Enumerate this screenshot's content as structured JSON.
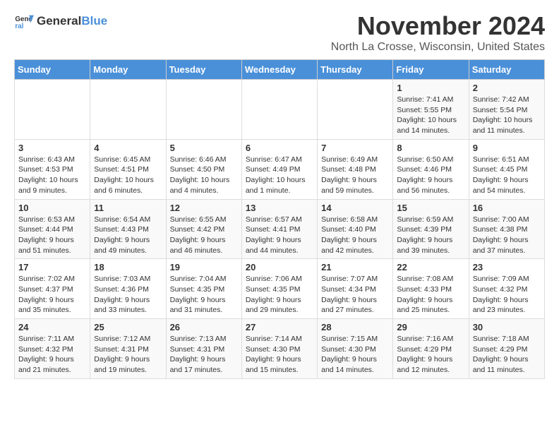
{
  "logo": {
    "general": "General",
    "blue": "Blue"
  },
  "title": "November 2024",
  "subtitle": "North La Crosse, Wisconsin, United States",
  "headers": [
    "Sunday",
    "Monday",
    "Tuesday",
    "Wednesday",
    "Thursday",
    "Friday",
    "Saturday"
  ],
  "weeks": [
    [
      {
        "day": "",
        "info": ""
      },
      {
        "day": "",
        "info": ""
      },
      {
        "day": "",
        "info": ""
      },
      {
        "day": "",
        "info": ""
      },
      {
        "day": "",
        "info": ""
      },
      {
        "day": "1",
        "info": "Sunrise: 7:41 AM\nSunset: 5:55 PM\nDaylight: 10 hours and 14 minutes."
      },
      {
        "day": "2",
        "info": "Sunrise: 7:42 AM\nSunset: 5:54 PM\nDaylight: 10 hours and 11 minutes."
      }
    ],
    [
      {
        "day": "3",
        "info": "Sunrise: 6:43 AM\nSunset: 4:53 PM\nDaylight: 10 hours and 9 minutes."
      },
      {
        "day": "4",
        "info": "Sunrise: 6:45 AM\nSunset: 4:51 PM\nDaylight: 10 hours and 6 minutes."
      },
      {
        "day": "5",
        "info": "Sunrise: 6:46 AM\nSunset: 4:50 PM\nDaylight: 10 hours and 4 minutes."
      },
      {
        "day": "6",
        "info": "Sunrise: 6:47 AM\nSunset: 4:49 PM\nDaylight: 10 hours and 1 minute."
      },
      {
        "day": "7",
        "info": "Sunrise: 6:49 AM\nSunset: 4:48 PM\nDaylight: 9 hours and 59 minutes."
      },
      {
        "day": "8",
        "info": "Sunrise: 6:50 AM\nSunset: 4:46 PM\nDaylight: 9 hours and 56 minutes."
      },
      {
        "day": "9",
        "info": "Sunrise: 6:51 AM\nSunset: 4:45 PM\nDaylight: 9 hours and 54 minutes."
      }
    ],
    [
      {
        "day": "10",
        "info": "Sunrise: 6:53 AM\nSunset: 4:44 PM\nDaylight: 9 hours and 51 minutes."
      },
      {
        "day": "11",
        "info": "Sunrise: 6:54 AM\nSunset: 4:43 PM\nDaylight: 9 hours and 49 minutes."
      },
      {
        "day": "12",
        "info": "Sunrise: 6:55 AM\nSunset: 4:42 PM\nDaylight: 9 hours and 46 minutes."
      },
      {
        "day": "13",
        "info": "Sunrise: 6:57 AM\nSunset: 4:41 PM\nDaylight: 9 hours and 44 minutes."
      },
      {
        "day": "14",
        "info": "Sunrise: 6:58 AM\nSunset: 4:40 PM\nDaylight: 9 hours and 42 minutes."
      },
      {
        "day": "15",
        "info": "Sunrise: 6:59 AM\nSunset: 4:39 PM\nDaylight: 9 hours and 39 minutes."
      },
      {
        "day": "16",
        "info": "Sunrise: 7:00 AM\nSunset: 4:38 PM\nDaylight: 9 hours and 37 minutes."
      }
    ],
    [
      {
        "day": "17",
        "info": "Sunrise: 7:02 AM\nSunset: 4:37 PM\nDaylight: 9 hours and 35 minutes."
      },
      {
        "day": "18",
        "info": "Sunrise: 7:03 AM\nSunset: 4:36 PM\nDaylight: 9 hours and 33 minutes."
      },
      {
        "day": "19",
        "info": "Sunrise: 7:04 AM\nSunset: 4:35 PM\nDaylight: 9 hours and 31 minutes."
      },
      {
        "day": "20",
        "info": "Sunrise: 7:06 AM\nSunset: 4:35 PM\nDaylight: 9 hours and 29 minutes."
      },
      {
        "day": "21",
        "info": "Sunrise: 7:07 AM\nSunset: 4:34 PM\nDaylight: 9 hours and 27 minutes."
      },
      {
        "day": "22",
        "info": "Sunrise: 7:08 AM\nSunset: 4:33 PM\nDaylight: 9 hours and 25 minutes."
      },
      {
        "day": "23",
        "info": "Sunrise: 7:09 AM\nSunset: 4:32 PM\nDaylight: 9 hours and 23 minutes."
      }
    ],
    [
      {
        "day": "24",
        "info": "Sunrise: 7:11 AM\nSunset: 4:32 PM\nDaylight: 9 hours and 21 minutes."
      },
      {
        "day": "25",
        "info": "Sunrise: 7:12 AM\nSunset: 4:31 PM\nDaylight: 9 hours and 19 minutes."
      },
      {
        "day": "26",
        "info": "Sunrise: 7:13 AM\nSunset: 4:31 PM\nDaylight: 9 hours and 17 minutes."
      },
      {
        "day": "27",
        "info": "Sunrise: 7:14 AM\nSunset: 4:30 PM\nDaylight: 9 hours and 15 minutes."
      },
      {
        "day": "28",
        "info": "Sunrise: 7:15 AM\nSunset: 4:30 PM\nDaylight: 9 hours and 14 minutes."
      },
      {
        "day": "29",
        "info": "Sunrise: 7:16 AM\nSunset: 4:29 PM\nDaylight: 9 hours and 12 minutes."
      },
      {
        "day": "30",
        "info": "Sunrise: 7:18 AM\nSunset: 4:29 PM\nDaylight: 9 hours and 11 minutes."
      }
    ]
  ]
}
